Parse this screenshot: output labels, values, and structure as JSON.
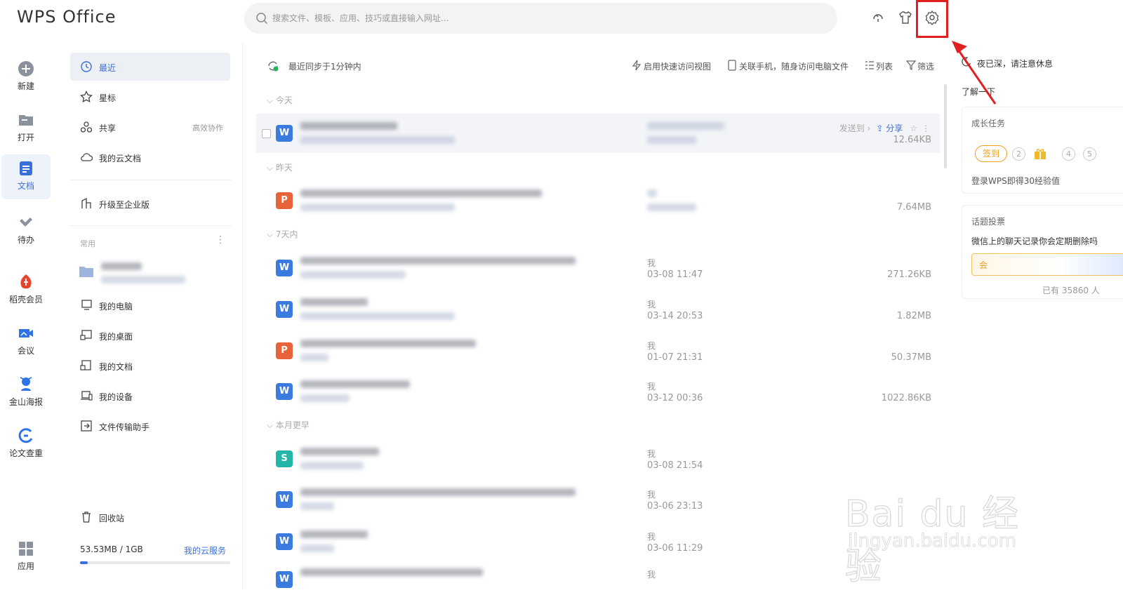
{
  "app": {
    "logo": "WPS Office"
  },
  "search": {
    "placeholder": "搜索文件、模板、应用、技巧或直接输入网址..."
  },
  "rail": [
    {
      "label": "新建",
      "icon": "plus-circle-icon"
    },
    {
      "label": "打开",
      "icon": "folder-icon"
    },
    {
      "label": "文档",
      "icon": "document-icon",
      "active": true
    },
    {
      "label": "待办",
      "icon": "check-icon"
    },
    {
      "label": "稻壳会员",
      "icon": "docer-icon"
    },
    {
      "label": "会议",
      "icon": "meeting-icon"
    },
    {
      "label": "金山海报",
      "icon": "poster-icon"
    },
    {
      "label": "论文查重",
      "icon": "paper-check-icon"
    },
    {
      "label": "应用",
      "icon": "apps-grid-icon"
    }
  ],
  "panel": {
    "nav": [
      {
        "label": "最近",
        "active": true
      },
      {
        "label": "星标"
      },
      {
        "label": "共享",
        "extra": "高效协作"
      },
      {
        "label": "我的云文档"
      }
    ],
    "upgrade": "升级至企业版",
    "common_title": "常用",
    "more": "⋮",
    "locations": [
      {
        "label": "我的电脑"
      },
      {
        "label": "我的桌面"
      },
      {
        "label": "我的文档"
      },
      {
        "label": "我的设备"
      },
      {
        "label": "文件传输助手"
      }
    ],
    "trash": "回收站",
    "storage": {
      "used": "53.53MB / 1GB",
      "link": "我的云服务",
      "fraction": 0.052
    }
  },
  "toolbar": {
    "sync": "最近同步于1分钟内",
    "quick_view": "启用快速访问视图",
    "phone": "关联手机，随身访问电脑文件",
    "list": "列表",
    "filter": "筛选"
  },
  "groups": {
    "today": "今天",
    "yesterday": "昨天",
    "week": "7天内",
    "earlier": "本月更早"
  },
  "files": [
    {
      "type": "W",
      "color": "#3b7be0",
      "owner": "",
      "date": "",
      "size": "12.64KB",
      "send": "发送到 ›",
      "share": "分享"
    },
    {
      "type": "P",
      "color": "#e8623a",
      "owner": "",
      "date": "",
      "size": "7.64MB"
    },
    {
      "type": "W",
      "color": "#3b7be0",
      "owner": "我",
      "date": "03-08 11:47",
      "size": "271.26KB"
    },
    {
      "type": "W",
      "color": "#3b7be0",
      "owner": "我",
      "date": "03-14 20:53",
      "size": "1.82MB"
    },
    {
      "type": "P",
      "color": "#e8623a",
      "owner": "我",
      "date": "01-07 21:31",
      "size": "50.37MB"
    },
    {
      "type": "W",
      "color": "#3b7be0",
      "owner": "我",
      "date": "03-12 00:36",
      "size": "1022.86KB"
    },
    {
      "type": "S",
      "color": "#23b5a8",
      "owner": "我",
      "date": "03-08 21:54",
      "size": ""
    },
    {
      "type": "W",
      "color": "#3b7be0",
      "owner": "我",
      "date": "03-06 23:13",
      "size": ""
    },
    {
      "type": "W",
      "color": "#3b7be0",
      "owner": "我",
      "date": "03-06 11:29",
      "size": ""
    },
    {
      "type": "W",
      "color": "#3b7be0",
      "owner": "我",
      "date": "",
      "size": ""
    }
  ],
  "right": {
    "notice": "夜已深，请注意休息",
    "learn": "了解一下",
    "growth_title": "成长任务",
    "sign": "签到",
    "steps": [
      "2",
      "4",
      "5"
    ],
    "growth_sub": "登录WPS即得30经验值",
    "vote_title": "话题投票",
    "vote_q": "微信上的聊天记录你会定期删除吗",
    "vote_opt": "会",
    "vote_count": "已有 35860 人"
  },
  "watermark": {
    "main": "Bai du 经验",
    "sub": "jingyan.baidu.com"
  }
}
